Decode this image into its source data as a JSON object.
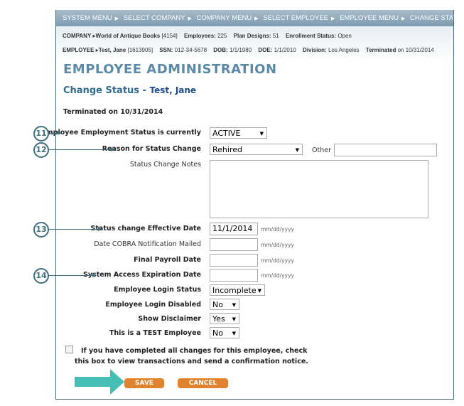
{
  "breadcrumb": [
    "SYSTEM MENU",
    "SELECT COMPANY",
    "COMPANY MENU",
    "SELECT EMPLOYEE",
    "EMPLOYEE MENU",
    "CHANGE STATUS"
  ],
  "company": {
    "label": "COMPANY",
    "name": "World of Antique Books",
    "id": "[4154]",
    "employees_label": "Employees:",
    "employees": "225",
    "plans_label": "Plan Designs:",
    "plans": "51",
    "enroll_label": "Enrollment Status:",
    "enroll": "Open"
  },
  "employee": {
    "label": "EMPLOYEE",
    "name": "Test, Jane",
    "id": "[1613905]",
    "ssn_label": "SSN:",
    "ssn": "012-34-5678",
    "dob_label": "DOB:",
    "dob": "1/1/1980",
    "doe_label": "DOE:",
    "doe": "1/1/2010",
    "div_label": "Division:",
    "div": "Los Angeles",
    "term_label": "Terminated",
    "term": "on 10/31/2014"
  },
  "page_title": "EMPLOYEE ADMINISTRATION",
  "subtitle": "Change Status - ",
  "subtitle_name": "Test, Jane",
  "terminated_note": "Terminated on 10/31/2014",
  "form": {
    "status_label": "Employee Employment Status is currently",
    "status_value": "ACTIVE",
    "reason_label": "Reason for Status Change",
    "reason_value": "Rehired",
    "other_label": "Other",
    "other_value": "",
    "notes_label": "Status Change Notes",
    "notes_value": "",
    "eff_label": "Status change Effective Date",
    "eff_value": "11/1/2014",
    "cobra_label": "Date COBRA Notification Mailed",
    "cobra_value": "",
    "payroll_label": "Final Payroll Date",
    "payroll_value": "",
    "access_label": "System Access Expiration Date",
    "access_value": "",
    "date_format": "mm/dd/yyyy",
    "login_status_label": "Employee Login Status",
    "login_status_value": "Incomplete",
    "login_disabled_label": "Employee Login Disabled",
    "login_disabled_value": "No",
    "disclaimer_label": "Show Disclaimer",
    "disclaimer_value": "Yes",
    "test_label": "This is a TEST Employee",
    "test_value": "No"
  },
  "confirm_text": "If you have completed all changes for this employee, check this box to view transactions and send a confirmation notice.",
  "save_label": "SAVE",
  "cancel_label": "CANCEL",
  "callouts": [
    "11",
    "12",
    "13",
    "14"
  ],
  "colors": {
    "accent": "#e0832e",
    "title": "#5b8aa6",
    "arrow": "#45bfb5"
  }
}
